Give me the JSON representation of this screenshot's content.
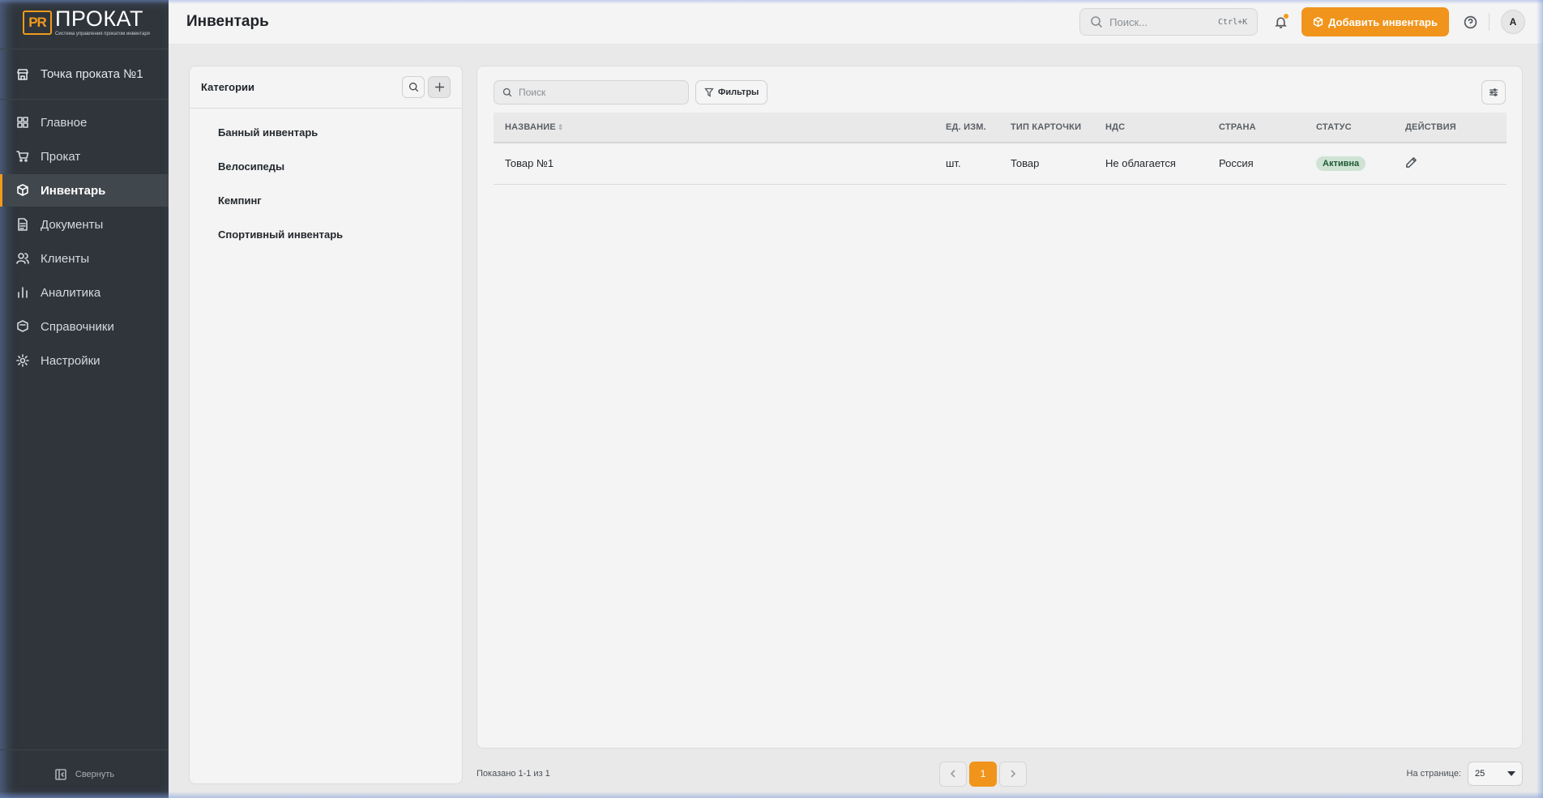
{
  "brand": {
    "mark": "PR",
    "name": "ПРОКАТ",
    "subtitle": "Система управления прокатом инвентаря"
  },
  "sidebar": {
    "point": "Точка проката №1",
    "items": [
      {
        "label": "Главное",
        "icon": "grid-icon",
        "active": false
      },
      {
        "label": "Прокат",
        "icon": "cart-icon",
        "active": false
      },
      {
        "label": "Инвентарь",
        "icon": "boxes-icon",
        "active": true
      },
      {
        "label": "Документы",
        "icon": "document-icon",
        "active": false
      },
      {
        "label": "Клиенты",
        "icon": "users-icon",
        "active": false
      },
      {
        "label": "Аналитика",
        "icon": "chart-icon",
        "active": false
      },
      {
        "label": "Справочники",
        "icon": "book-icon",
        "active": false
      },
      {
        "label": "Настройки",
        "icon": "gear-icon",
        "active": false
      }
    ],
    "collapse_label": "Свернуть"
  },
  "header": {
    "title": "Инвентарь",
    "search_placeholder": "Поиск...",
    "search_shortcut": "Ctrl+K",
    "add_button": "Добавить инвентарь",
    "avatar": "А"
  },
  "categories": {
    "title": "Категории",
    "items": [
      "Банный инвентарь",
      "Велосипеды",
      "Кемпинг",
      "Спортивный инвентарь"
    ]
  },
  "table": {
    "search_placeholder": "Поиск",
    "filters_label": "Фильтры",
    "columns": [
      "Название",
      "Ед. изм.",
      "Тип карточки",
      "НДС",
      "Страна",
      "Статус",
      "Действия"
    ],
    "rows": [
      {
        "name": "Товар №1",
        "unit": "шт.",
        "card_type": "Товар",
        "vat": "Не облагается",
        "country": "Россия",
        "status": "Активна"
      }
    ]
  },
  "footer": {
    "shown": "Показано 1-1 из 1",
    "current_page": "1",
    "per_page_label": "На странице:",
    "per_page_value": "25"
  },
  "colors": {
    "accent": "#f0941b",
    "sidebar_bg": "#2f353b",
    "status_active_bg": "#cfe3d4"
  }
}
